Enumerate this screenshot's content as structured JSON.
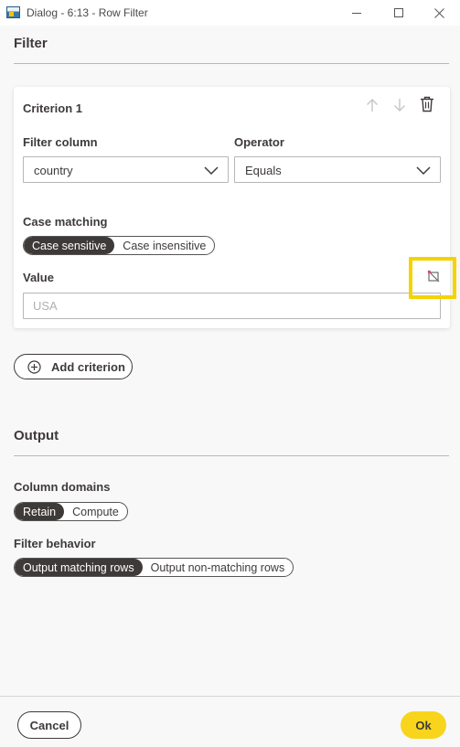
{
  "window": {
    "title": "Dialog - 6:13 - Row Filter"
  },
  "filter_section": {
    "title": "Filter",
    "criterion": {
      "title": "Criterion 1",
      "filter_column_label": "Filter column",
      "filter_column_value": "country",
      "operator_label": "Operator",
      "operator_value": "Equals",
      "case_matching_label": "Case matching",
      "case_options": [
        "Case sensitive",
        "Case insensitive"
      ],
      "case_selected": "Case sensitive",
      "value_label": "Value",
      "value_placeholder": "USA"
    },
    "add_criterion_label": "Add criterion"
  },
  "output_section": {
    "title": "Output",
    "column_domains_label": "Column domains",
    "column_domains_options": [
      "Retain",
      "Compute"
    ],
    "column_domains_selected": "Retain",
    "filter_behavior_label": "Filter behavior",
    "filter_behavior_options": [
      "Output matching rows",
      "Output non-matching rows"
    ],
    "filter_behavior_selected": "Output matching rows"
  },
  "footer": {
    "cancel_label": "Cancel",
    "ok_label": "Ok"
  },
  "colors": {
    "accent_yellow": "#f8d51c",
    "highlight_yellow": "#f4d300",
    "text_dark": "#3e3a39",
    "toggle_active_bg": "#3e3a39"
  },
  "icons": {
    "move_up": "arrow-up-icon",
    "move_down": "arrow-down-icon",
    "delete": "trash-icon",
    "reset_value": "reset-value-icon",
    "add": "plus-circle-icon"
  }
}
